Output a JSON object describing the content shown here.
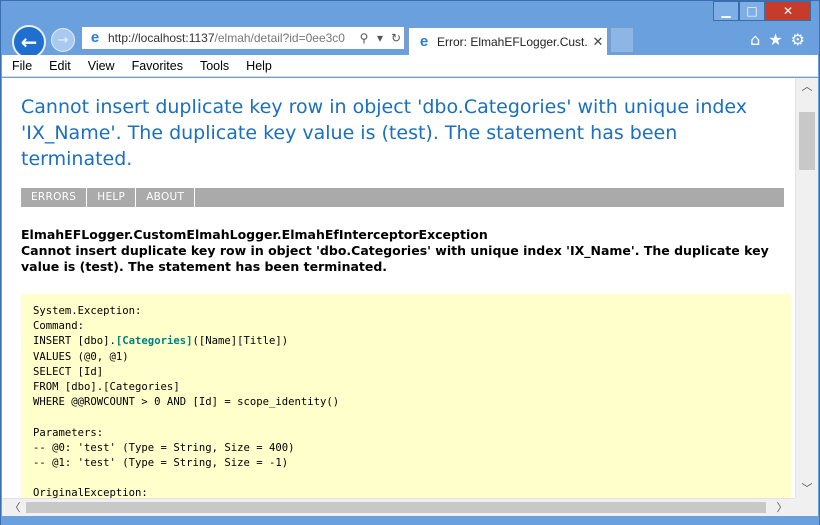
{
  "browser": {
    "address": {
      "url_host": "http://localhost:1137",
      "url_path": "/elmah/detail?id=0ee3c0",
      "search_glyph": "⚲",
      "dropdown_glyph": "▾",
      "refresh_glyph": "↻"
    },
    "tab": {
      "title": "Error: ElmahEFLogger.Cust...",
      "close_glyph": "✕"
    },
    "icons": {
      "back": "back-arrow-icon",
      "forward": "forward-arrow-icon",
      "home": "home-icon",
      "favorites": "star-icon",
      "tools": "gear-icon",
      "ie_logo": "ie-logo-icon"
    },
    "window_controls": {
      "minimize": "▁",
      "maximize": "□",
      "close": "✕"
    }
  },
  "menu": {
    "items": [
      "File",
      "Edit",
      "View",
      "Favorites",
      "Tools",
      "Help"
    ]
  },
  "page": {
    "title": "Cannot insert duplicate key row in object 'dbo.Categories' with unique index 'IX_Name'. The duplicate key value is (test). The statement has been terminated.",
    "nav": [
      "ERRORS",
      "HELP",
      "ABOUT"
    ],
    "exception_type": "ElmahEFLogger.CustomElmahLogger.ElmahEfInterceptorException",
    "exception_message": "Cannot insert duplicate key row in object 'dbo.Categories' with unique index 'IX_Name'. The duplicate key value is (test). The statement has been terminated.",
    "stack_lines": [
      "System.Exception:",
      "Command:",
      "INSERT [dbo].",
      "[Categories]",
      "([Name][Title])",
      "VALUES (@0, @1)",
      "SELECT [Id]",
      "FROM [dbo].[Categories]",
      "WHERE @@ROWCOUNT > 0 AND [Id] = scope_identity()",
      "",
      "Parameters:",
      "-- @0: 'test' (Type = String, Size = 400)",
      "-- @1: 'test' (Type = String, Size = -1)",
      "",
      "OriginalException:"
    ]
  },
  "colors": {
    "title_blue": "#1a6fbf",
    "stack_bg": "#ffffcc",
    "nav_gray": "#aaaaaa",
    "highlight_teal": "#008080",
    "chrome_blue": "#6aa0dd"
  }
}
